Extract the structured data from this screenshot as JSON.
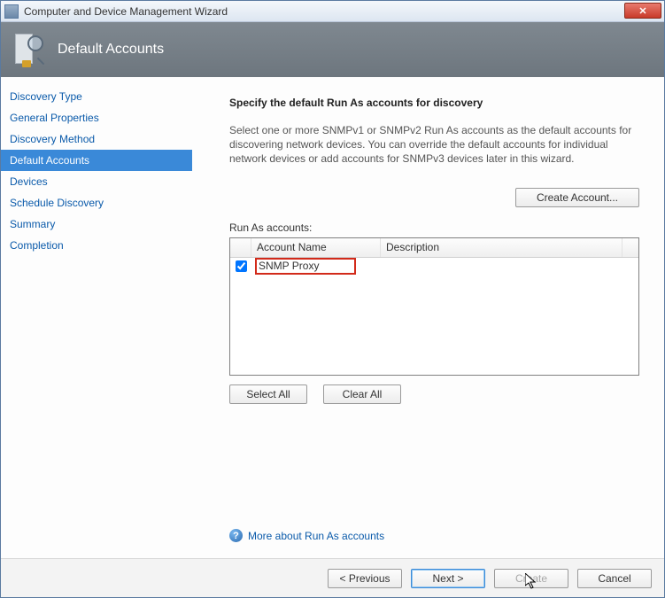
{
  "window": {
    "title": "Computer and Device Management Wizard",
    "close_label": "✕"
  },
  "banner": {
    "title": "Default Accounts"
  },
  "sidebar": {
    "items": [
      {
        "label": "Discovery Type",
        "active": false
      },
      {
        "label": "General Properties",
        "active": false
      },
      {
        "label": "Discovery Method",
        "active": false
      },
      {
        "label": "Default Accounts",
        "active": true
      },
      {
        "label": "Devices",
        "active": false
      },
      {
        "label": "Schedule Discovery",
        "active": false
      },
      {
        "label": "Summary",
        "active": false
      },
      {
        "label": "Completion",
        "active": false
      }
    ]
  },
  "content": {
    "heading": "Specify the default Run As accounts for discovery",
    "description": "Select one or more SNMPv1 or SNMPv2 Run As accounts as the default accounts for discovering network devices. You can override the default accounts for individual network devices or add accounts for SNMPv3 devices later in this wizard.",
    "create_button": "Create Account...",
    "list_label": "Run As accounts:",
    "columns": {
      "name": "Account Name",
      "description": "Description"
    },
    "rows": [
      {
        "checked": true,
        "name": "SNMP Proxy",
        "description": "",
        "highlight": true
      }
    ],
    "select_all": "Select All",
    "clear_all": "Clear All",
    "more_link": "More about Run As accounts",
    "help_glyph": "?"
  },
  "footer": {
    "previous": "< Previous",
    "next": "Next >",
    "create": "Create",
    "cancel": "Cancel",
    "create_enabled": false
  }
}
